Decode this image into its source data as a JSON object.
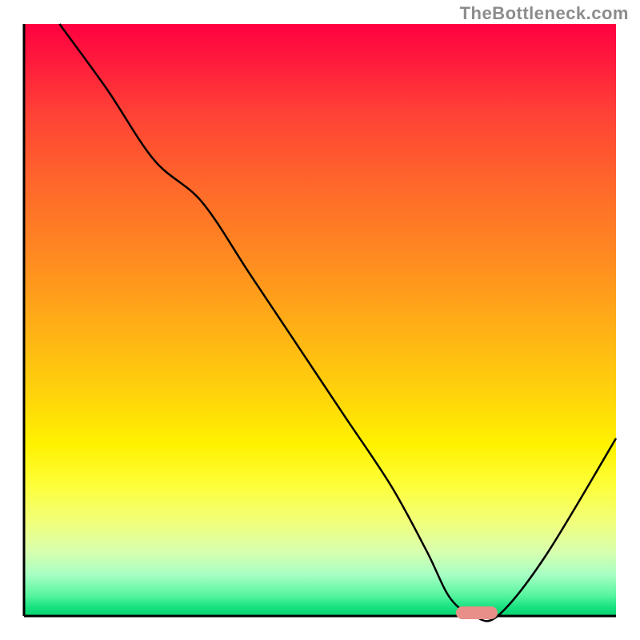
{
  "attribution": "TheBottleneck.com",
  "colors": {
    "top": "#ff0040",
    "mid": "#fff200",
    "bottom": "#04d46f",
    "marker": "#e78f88",
    "curve": "#000000"
  },
  "chart_data": {
    "type": "line",
    "title": "",
    "xlabel": "",
    "ylabel": "",
    "xlim": [
      0,
      100
    ],
    "ylim": [
      0,
      100
    ],
    "x": [
      6,
      14,
      22,
      30,
      38,
      46,
      54,
      62,
      68,
      72,
      76,
      80,
      88,
      100
    ],
    "y": [
      100,
      89,
      77,
      70,
      58,
      46,
      34,
      22,
      11,
      3,
      0,
      0,
      10,
      30
    ],
    "optimum_x_range": [
      73,
      80
    ],
    "notes": "Heat-map style background: top red = high bottleneck, bottom green = no bottleneck; black curve shows bottleneck % vs. configuration axis; pink pill marks the optimal zone on the x-axis."
  }
}
